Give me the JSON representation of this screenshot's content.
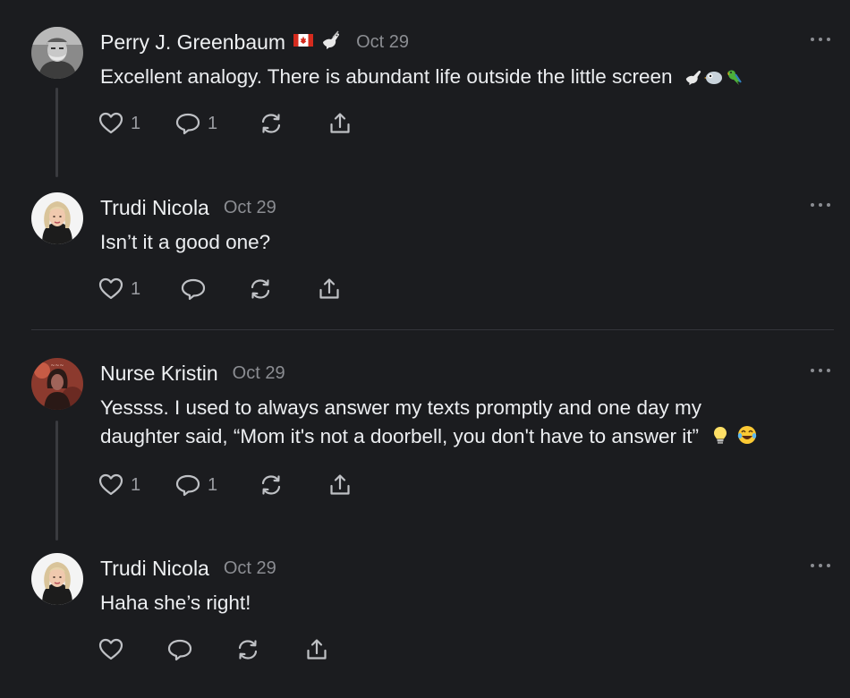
{
  "comments": [
    {
      "author": "Perry J. Greenbaum",
      "flair": [
        "canada-flag-emoji",
        "dove-emoji"
      ],
      "date": "Oct 29",
      "text": "Excellent analogy. There is abundant life outside the little screen",
      "text_emojis": [
        "dove-emoji",
        "bird-emoji",
        "parrot-emoji"
      ],
      "likes": "1",
      "replies": "1",
      "avatar": "man-photo-grayscale"
    },
    {
      "author": "Trudi Nicola",
      "date": "Oct 29",
      "text": "Isn’t it a good one?",
      "likes": "1",
      "replies": "",
      "avatar": "woman-illustration-blonde"
    },
    {
      "author": "Nurse Kristin",
      "date": "Oct 29",
      "text_line1": "Yessss. I used to always answer my texts promptly and one day my",
      "text_line2": "daughter said, “Mom it's not a doorbell, you don't have to answer it”",
      "text_emojis": [
        "lightbulb-emoji",
        "laughing-tears-emoji"
      ],
      "likes": "1",
      "replies": "1",
      "avatar": "woman-photo-red"
    },
    {
      "author": "Trudi Nicola",
      "date": "Oct 29",
      "text": "Haha she’s right!",
      "likes": "",
      "replies": "",
      "avatar": "woman-illustration-blonde"
    }
  ],
  "colors": {
    "background": "#1b1c1f",
    "text": "#eceef1",
    "muted": "#8b8d92",
    "line": "#3a3b3f"
  }
}
